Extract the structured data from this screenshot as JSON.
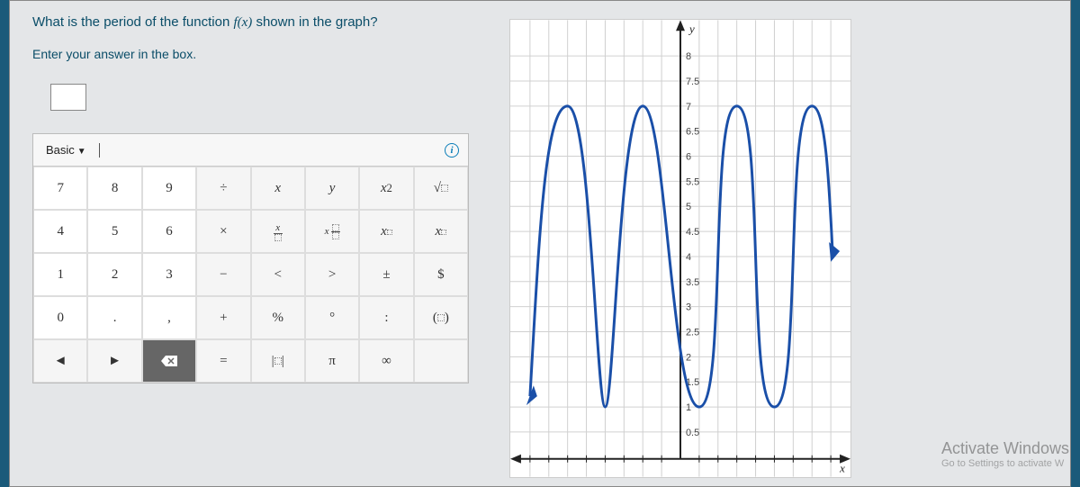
{
  "question": {
    "prompt_prefix": "What is the period of the function ",
    "fx": "f(x)",
    "prompt_suffix": " shown in the graph?",
    "instruction": "Enter your answer in the box."
  },
  "keypad": {
    "mode": "Basic",
    "info": "i",
    "rows": [
      [
        "7",
        "8",
        "9",
        "÷",
        "x",
        "y",
        "x²",
        "√▢"
      ],
      [
        "4",
        "5",
        "6",
        "×",
        "x/▢",
        "x▢/▢",
        "x^▢",
        "x_▢"
      ],
      [
        "1",
        "2",
        "3",
        "−",
        "<",
        ">",
        "±",
        "$"
      ],
      [
        "0",
        ".",
        ",",
        "+",
        "%",
        "°",
        ":",
        "(▢)"
      ],
      [
        "◄",
        "►",
        "⌫",
        "=",
        "|▢|",
        "π",
        "∞",
        ""
      ]
    ]
  },
  "chart_data": {
    "type": "line",
    "title": "",
    "xlabel": "x",
    "ylabel": "y",
    "xlim": [
      -8,
      8
    ],
    "ylim": [
      0,
      8
    ],
    "y_ticks": [
      0.5,
      1,
      1.5,
      2,
      2.5,
      3,
      3.5,
      4,
      4.5,
      5,
      5.5,
      6,
      6.5,
      7,
      7.5,
      8
    ],
    "description": "Periodic curve oscillating between y≈1 and y≈7 with period 4 along x",
    "series": [
      {
        "name": "f(x)",
        "peaks_x": [
          -5,
          -1,
          3,
          7
        ],
        "troughs_x": [
          -7,
          -3,
          1,
          5
        ],
        "peak_y": 7,
        "trough_y": 1,
        "period": 4
      }
    ]
  },
  "watermark": {
    "title": "Activate Windows",
    "sub": "Go to Settings to activate W"
  }
}
